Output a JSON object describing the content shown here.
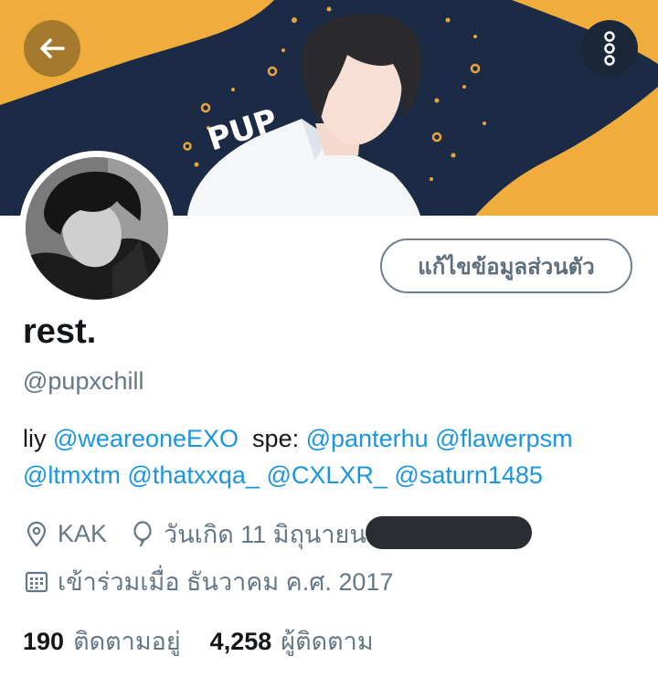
{
  "banner": {
    "text": "PUP",
    "colors": {
      "navy": "#1c2b45",
      "gold": "#f0ad3c",
      "accent": "#e9a63a"
    }
  },
  "header": {
    "back_icon": "arrow-left-icon",
    "more_icon": "kebab-vertical-icon"
  },
  "profile": {
    "edit_button_label": "แก้ไขข้อมูลส่วนตัว",
    "display_name": "rest.",
    "handle": "@pupxchill",
    "bio": {
      "prefix_1": "liy",
      "mention_1": "@weareoneEXO",
      "prefix_2": "spe:",
      "mention_2": "@panterhu",
      "mention_3": "@flawerpsm",
      "mention_4": "@ltmxtm",
      "mention_5": "@thatxxqa_",
      "mention_6": "@CXLXR_",
      "mention_7": "@saturn1485"
    },
    "location": "KAK",
    "location_icon": "location-pin-icon",
    "birthday": "วันเกิด 11 มิถุนายน",
    "birthday_icon": "balloon-icon",
    "joined": "เข้าร่วมเมื่อ ธันวาคม ค.ศ. 2017",
    "joined_icon": "calendar-icon"
  },
  "stats": {
    "following_count": "190",
    "following_label": "ติดตามอยู่",
    "followers_count": "4,258",
    "followers_label": "ผู้ติดตาม"
  },
  "colors": {
    "link": "#1b95e0",
    "secondary_text": "#657786",
    "primary_text": "#14171a"
  }
}
